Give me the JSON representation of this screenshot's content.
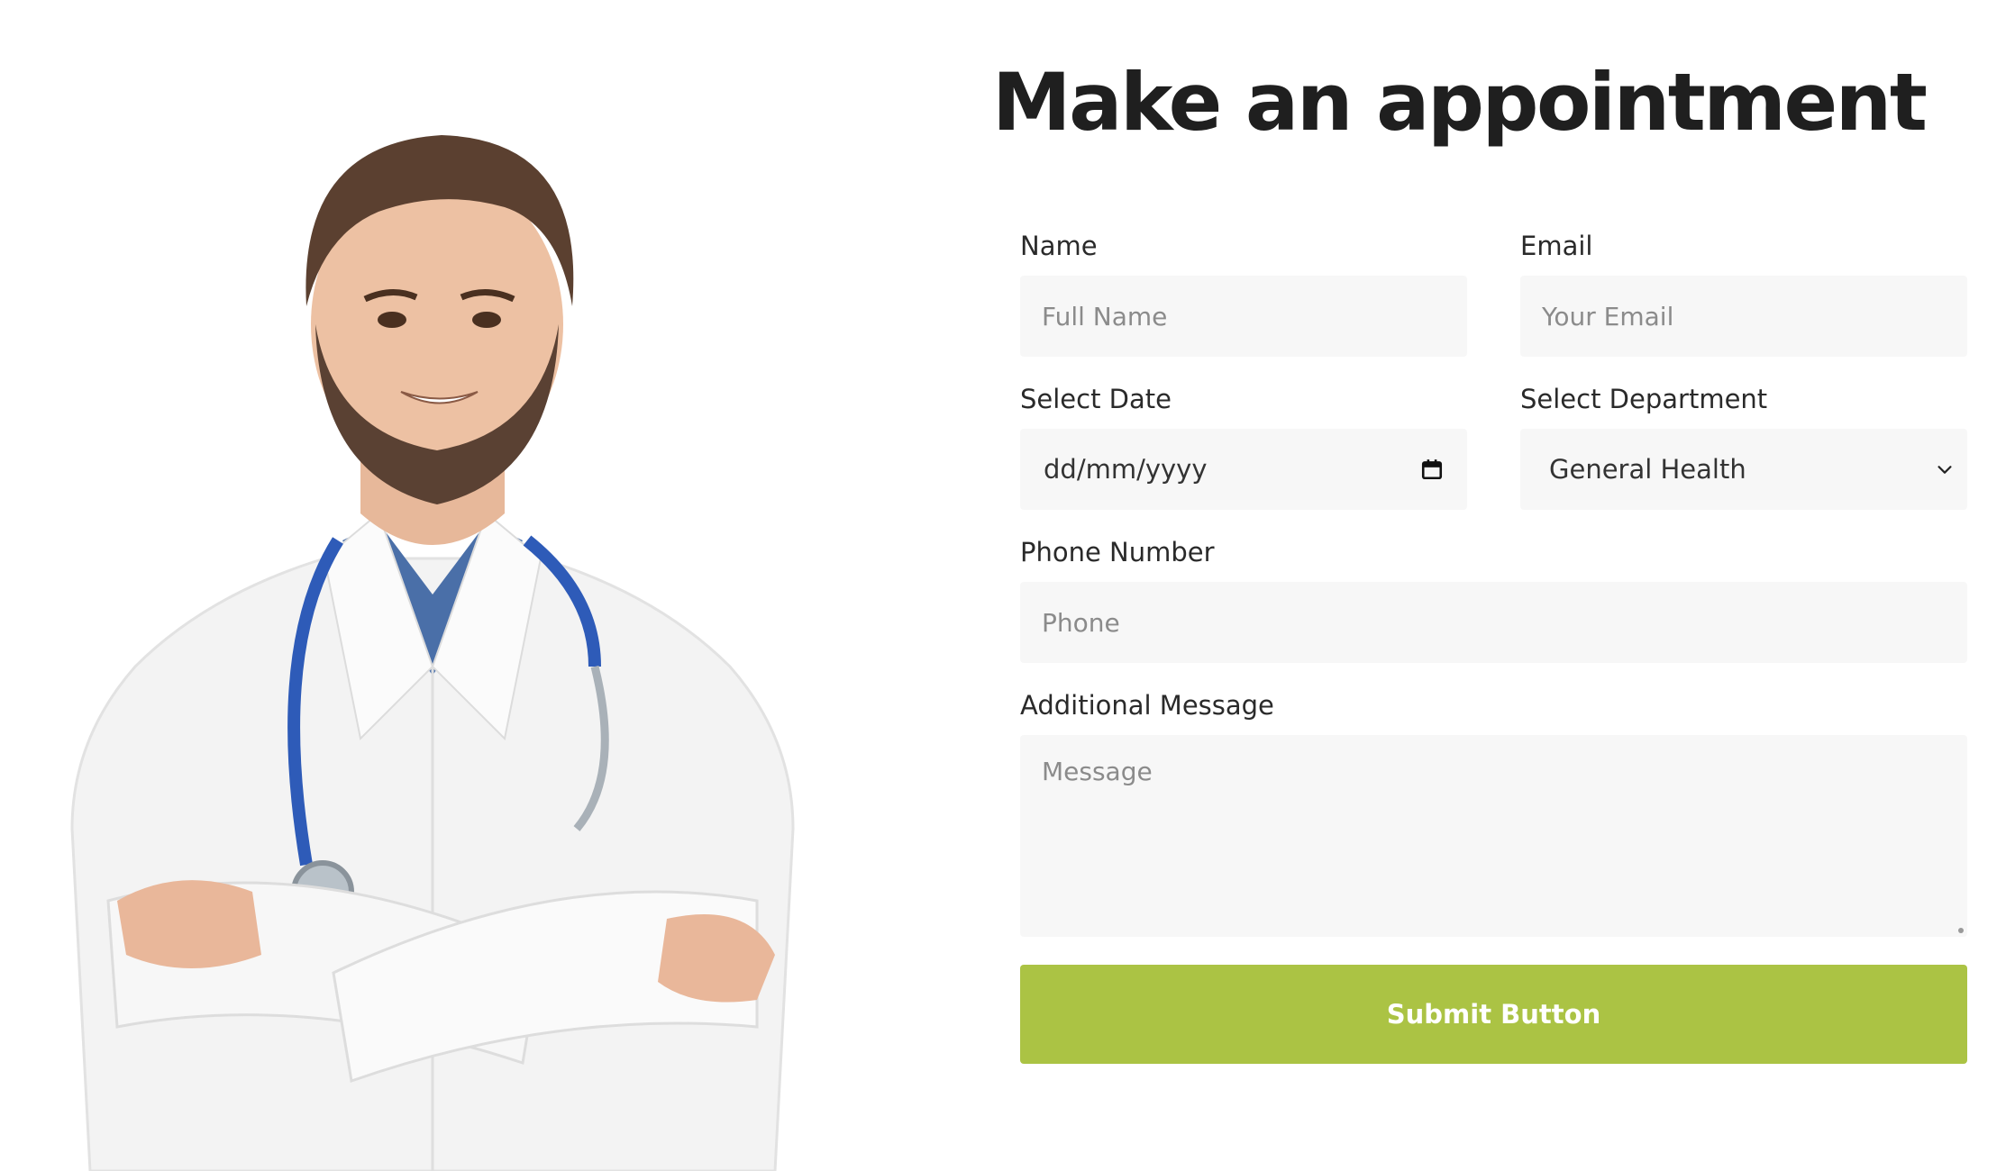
{
  "form": {
    "title": "Make an appointment",
    "name": {
      "label": "Name",
      "placeholder": "Full Name"
    },
    "email": {
      "label": "Email",
      "placeholder": "Your Email"
    },
    "date": {
      "label": "Select Date",
      "value": "dd/mm/yyyy",
      "icon": "calendar-icon"
    },
    "department": {
      "label": "Select Department",
      "selected": "General Health",
      "icon": "chevron-down-icon"
    },
    "phone": {
      "label": "Phone Number",
      "placeholder": "Phone"
    },
    "message": {
      "label": "Additional Message",
      "placeholder": "Message"
    },
    "submit_label": "Submit Button"
  },
  "colors": {
    "accent": "#abc344",
    "field_background": "#f7f7f7",
    "title": "#1f1f1f"
  }
}
